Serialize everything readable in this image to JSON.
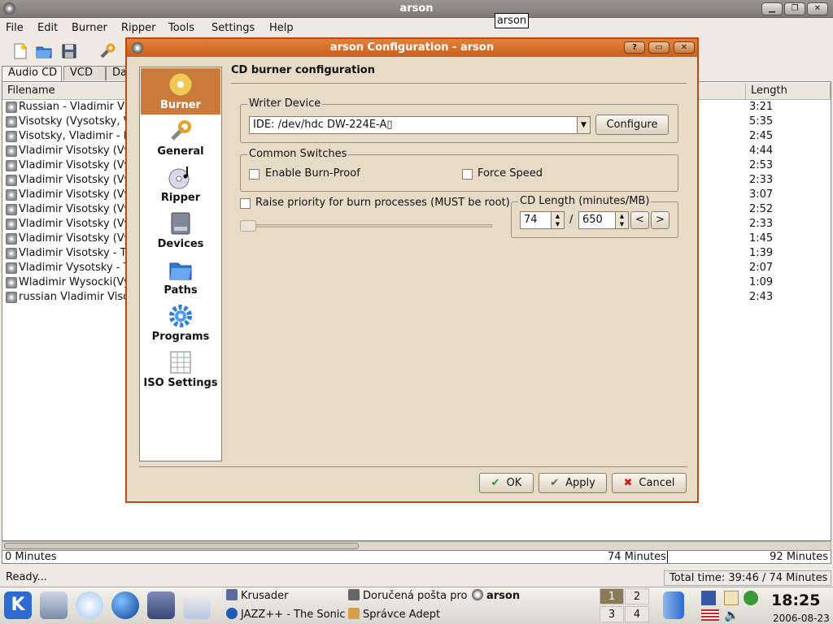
{
  "window": {
    "title": "arson",
    "tooltip": "arson"
  },
  "menubar": {
    "items": [
      "File",
      "Edit",
      "Burner",
      "Ripper",
      "Tools",
      "Settings",
      "Help"
    ]
  },
  "tabs": [
    "Audio CD",
    "VCD",
    "Da"
  ],
  "list": {
    "headers": {
      "filename": "Filename",
      "length": "Length"
    },
    "rows": [
      {
        "name": "Russian - Vladimir Vis",
        "length": "3:21"
      },
      {
        "name": "Visotsky (Vysotsky, V",
        "length": "5:35"
      },
      {
        "name": "Visotsky, Vladimir - Pe",
        "length": "2:45"
      },
      {
        "name": "Vladimir Visotsky (Vys",
        "length": "4:44"
      },
      {
        "name": "Vladimir Visotsky (Vys",
        "length": "2:53"
      },
      {
        "name": "Vladimir Visotsky (Vys",
        "length": "2:33"
      },
      {
        "name": "Vladimir Visotsky (Vys",
        "length": "3:07"
      },
      {
        "name": "Vladimir Visotsky (Vys",
        "length": "2:52"
      },
      {
        "name": "Vladimir Visotsky (Vys",
        "length": "2:33"
      },
      {
        "name": "Vladimir Visotsky (Vys",
        "length": "1:45"
      },
      {
        "name": "Vladimir Visotsky - Ta",
        "length": "1:39"
      },
      {
        "name": "Vladimir Vysotsky - Te",
        "length": "2:07"
      },
      {
        "name": "Wladimir Wysocki(Vys",
        "length": "1:09"
      },
      {
        "name": "russian Vladimir Visot",
        "length": "2:43"
      }
    ]
  },
  "progress": {
    "left": "0 Minutes",
    "mid": "74 Minutes",
    "right": "92 Minutes"
  },
  "status": {
    "left": "Ready...",
    "right": "Total time: 39:46 / 74 Minutes"
  },
  "dialog": {
    "title": "arson Configuration - arson",
    "heading": "CD burner configuration",
    "sidebar": [
      "Burner",
      "General",
      "Ripper",
      "Devices",
      "Paths",
      "Programs",
      "ISO Settings"
    ],
    "writer_label": "Writer Device",
    "writer_value": "IDE: /dev/hdc DW-224E-A▯",
    "configure": "Configure",
    "switches_label": "Common Switches",
    "burnproof": "Enable Burn-Proof",
    "forcespeed": "Force Speed",
    "raise": "Raise priority for burn processes (MUST be root)",
    "cdlength_label": "CD Length (minutes/MB)",
    "minutes": "74",
    "slash": "/",
    "mb": "650",
    "prev": "<",
    "next": ">",
    "ok": "OK",
    "apply": "Apply",
    "cancel": "Cancel"
  },
  "taskbar": {
    "tasks": [
      "Krusader",
      "Doručená pošta pro",
      "arson",
      "JAZZ++ - The Sonic",
      "Správce Adept"
    ],
    "desktops": [
      "1",
      "2",
      "3",
      "4"
    ],
    "time": "18:25",
    "date": "2006-08-23"
  }
}
